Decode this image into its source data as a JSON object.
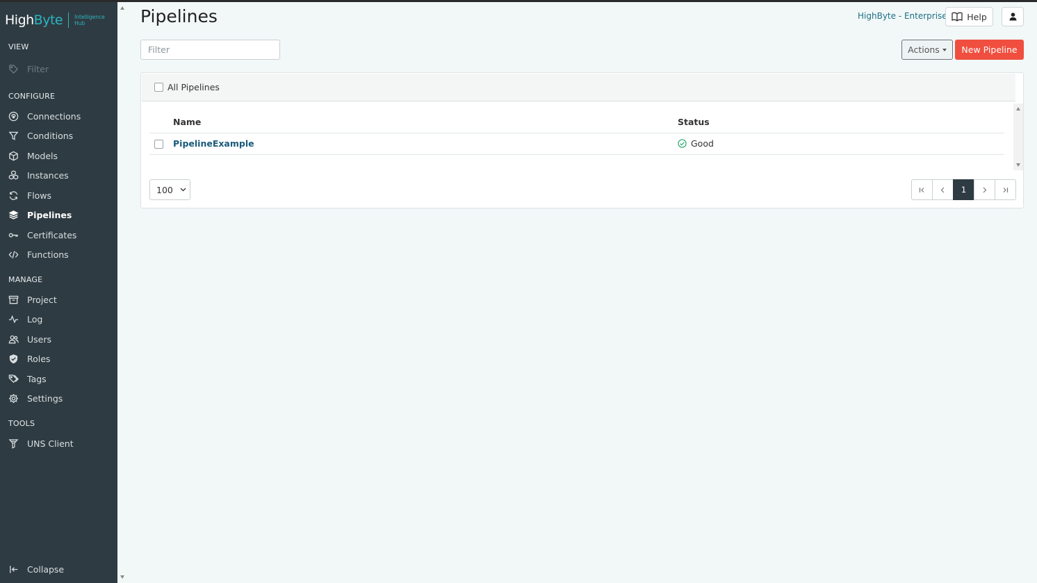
{
  "brand": {
    "logo_main": "High",
    "logo_accent": "Byte",
    "logo_sub_line1": "Intelligence",
    "logo_sub_line2": "Hub"
  },
  "sidebar": {
    "view_section": "VIEW",
    "view_filter": "Filter",
    "configure_section": "CONFIGURE",
    "configure_items": [
      "Connections",
      "Conditions",
      "Models",
      "Instances",
      "Flows",
      "Pipelines",
      "Certificates",
      "Functions"
    ],
    "active_item": "Pipelines",
    "manage_section": "MANAGE",
    "manage_items": [
      "Project",
      "Log",
      "Users",
      "Roles",
      "Tags",
      "Settings"
    ],
    "tools_section": "TOOLS",
    "tools_items": [
      "UNS Client"
    ],
    "collapse_label": "Collapse"
  },
  "header": {
    "title": "Pipelines",
    "edition_link": "HighByte - Enterprise",
    "help_label": "Help"
  },
  "toolbar": {
    "filter_placeholder": "Filter",
    "actions_label": "Actions",
    "new_pipeline_label": "New Pipeline"
  },
  "table": {
    "select_all_label": "All Pipelines",
    "columns": [
      "Name",
      "Status"
    ],
    "rows": [
      {
        "name": "PipelineExample",
        "status": "Good"
      }
    ]
  },
  "pagination": {
    "page_size": "100",
    "current_page": "1"
  },
  "colors": {
    "sidebar_bg": "#2f3b42",
    "brand_accent": "#2bb5c2",
    "primary_button": "#f04e3e",
    "link": "#1a5a7a",
    "status_good": "#2aa86a"
  }
}
